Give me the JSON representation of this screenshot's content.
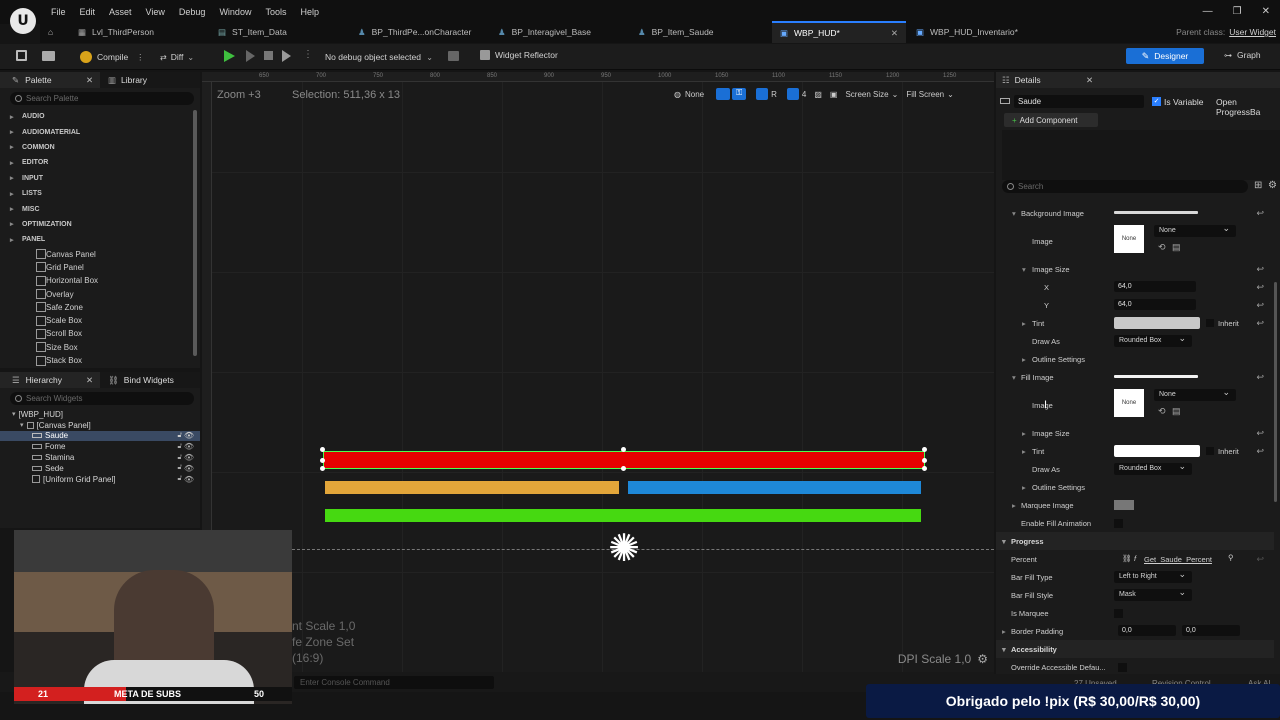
{
  "menu": [
    "File",
    "Edit",
    "Asset",
    "View",
    "Debug",
    "Window",
    "Tools",
    "Help"
  ],
  "tabs": [
    {
      "label": "Lvl_ThirdPerson",
      "active": false
    },
    {
      "label": "ST_Item_Data",
      "active": false
    },
    {
      "label": "BP_ThirdPe...onCharacter",
      "active": false
    },
    {
      "label": "BP_Interagivel_Base",
      "active": false
    },
    {
      "label": "BP_Item_Saude",
      "active": false
    },
    {
      "label": "WBP_HUD*",
      "active": true
    },
    {
      "label": "WBP_HUD_Inventario*",
      "active": false
    }
  ],
  "parent_class": {
    "label": "Parent class:",
    "value": "User Widget"
  },
  "toolbar": {
    "compile": "Compile",
    "diff": "Diff",
    "debug_select": "No debug object selected",
    "widget_reflector": "Widget Reflector",
    "designer": "Designer",
    "graph": "Graph"
  },
  "palette": {
    "tab": "Palette",
    "library_tab": "Library",
    "search_placeholder": "Search Palette",
    "categories": [
      "AUDIO",
      "AUDIOMATERIAL",
      "COMMON",
      "EDITOR",
      "INPUT",
      "LISTS",
      "MISC",
      "OPTIMIZATION",
      "PANEL"
    ],
    "panel_items": [
      "Canvas Panel",
      "Grid Panel",
      "Horizontal Box",
      "Overlay",
      "Safe Zone",
      "Scale Box",
      "Scroll Box",
      "Size Box",
      "Stack Box"
    ]
  },
  "hierarchy": {
    "tab": "Hierarchy",
    "bind_tab": "Bind Widgets",
    "search_placeholder": "Search Widgets",
    "root": "[WBP_HUD]",
    "canvas": "[Canvas Panel]",
    "items": [
      "Saude",
      "Fome",
      "Stamina",
      "Sede"
    ],
    "uniform": "[Uniform Grid Panel]"
  },
  "canvas": {
    "zoom": "Zoom +3",
    "selection": "Selection: 511,36 x 13",
    "ruler": [
      "650",
      "700",
      "750",
      "800",
      "850",
      "900",
      "950",
      "1000",
      "1050",
      "1100",
      "1150",
      "1200",
      "1250"
    ],
    "none_label": "None",
    "r_label": "R",
    "grid_num": "4",
    "screen_size": "Screen Size",
    "fill_screen": "Fill Screen",
    "dpi": "DPI Scale 1,0",
    "overlay_lines": [
      "nt Scale 1,0",
      "fe Zone Set",
      "(16:9)"
    ],
    "bars": {
      "red": "#e60000",
      "orange": "#e3a63a",
      "blue": "#1e88d8",
      "green": "#46d911"
    }
  },
  "console_placeholder": "Enter Console Command",
  "webcam": {
    "left": "21",
    "label": "META DE SUBS",
    "right": "50"
  },
  "details": {
    "tab": "Details",
    "name": "Saude",
    "is_variable": "Is Variable",
    "open_link": "Open ProgressBa",
    "add_component": "Add Component",
    "search": "Search",
    "rows": {
      "background_image": "Background Image",
      "image": "Image",
      "none": "None",
      "image_size": "Image Size",
      "x": "X",
      "y": "Y",
      "x_val": "64,0",
      "y_val": "64,0",
      "tint": "Tint",
      "inherit": "Inherit",
      "draw_as": "Draw As",
      "rounded_box": "Rounded Box",
      "outline": "Outline Settings",
      "fill_image": "Fill Image",
      "marquee_image": "Marquee Image",
      "enable_fill": "Enable Fill Animation",
      "progress": "Progress",
      "percent": "Percent",
      "percent_binding": "Get_Saude_Percent",
      "bar_fill_type": "Bar Fill Type",
      "left_to_right": "Left to Right",
      "bar_fill_style": "Bar Fill Style",
      "mask": "Mask",
      "is_marquee": "Is Marquee",
      "border_padding": "Border Padding",
      "bp1": "0,0",
      "bp2": "0,0",
      "accessibility": "Accessibility",
      "override": "Override Accessible Defau..."
    }
  },
  "status": {
    "unsaved": "27 Unsaved",
    "revision": "Revision Control",
    "ask": "Ask AI"
  },
  "banner": "Obrigado pelo !pix (R$ 30,00/R$ 30,00)"
}
